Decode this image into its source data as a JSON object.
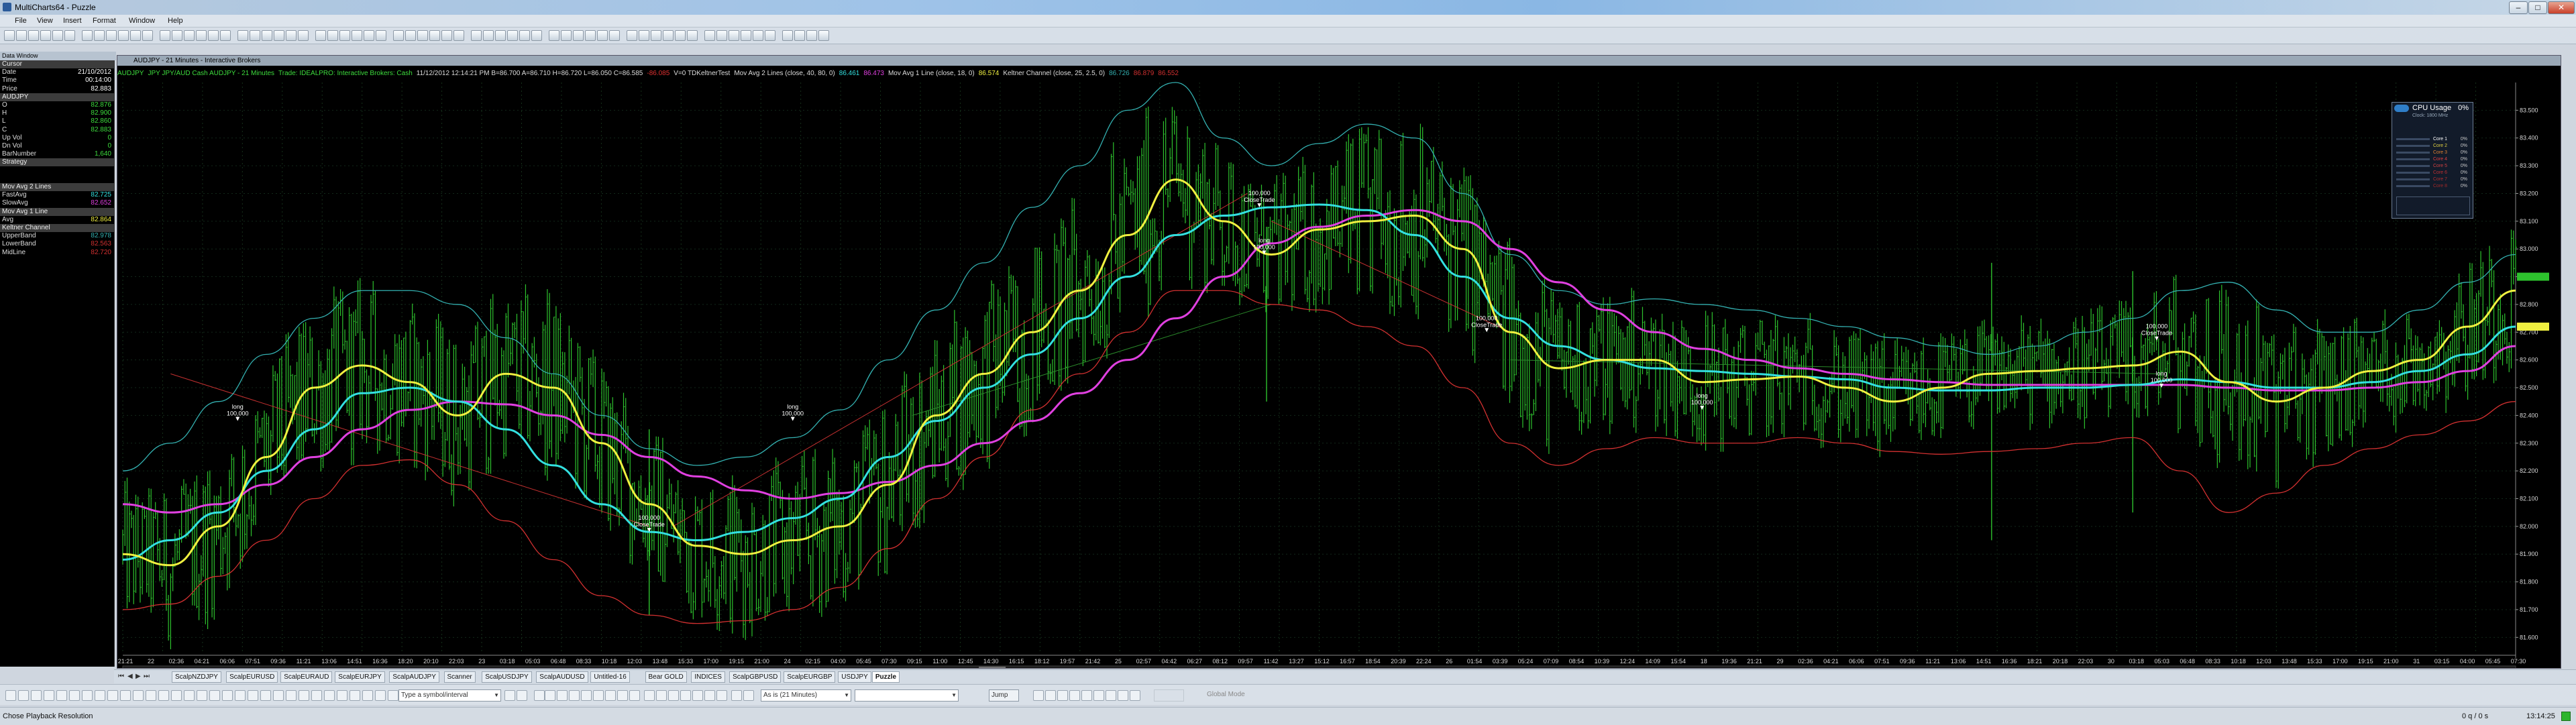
{
  "app": {
    "title": "MultiCharts64 - Puzzle",
    "menu": [
      "File",
      "View",
      "Insert",
      "Format",
      "Window",
      "Help"
    ]
  },
  "data_window": {
    "title": "Data Window",
    "rows": [
      {
        "k": "Cursor",
        "v": "",
        "section": true
      },
      {
        "k": "Date",
        "v": "21/10/2012",
        "color": "#ffffff"
      },
      {
        "k": "Time",
        "v": "00:14:00",
        "color": "#ffffff"
      },
      {
        "k": "Price",
        "v": "82.883",
        "color": "#ffffff"
      },
      {
        "k": "AUDJPY",
        "v": "",
        "section": true
      },
      {
        "k": "O",
        "v": "82.876",
        "color": "#3ddc3d"
      },
      {
        "k": "H",
        "v": "82.900",
        "color": "#3ddc3d"
      },
      {
        "k": "L",
        "v": "82.860",
        "color": "#3ddc3d"
      },
      {
        "k": "C",
        "v": "82.883",
        "color": "#3ddc3d"
      },
      {
        "k": "Up Vol",
        "v": "0",
        "color": "#3ddc3d"
      },
      {
        "k": "Dn Vol",
        "v": "0",
        "color": "#3ddc3d"
      },
      {
        "k": "BarNumber",
        "v": "1,640",
        "color": "#3ddc3d"
      },
      {
        "k": "Strategy",
        "v": "",
        "section": true
      },
      {
        "k": "",
        "v": ""
      },
      {
        "k": "",
        "v": ""
      },
      {
        "k": "Mov Avg 2 Lines",
        "v": "",
        "section": true
      },
      {
        "k": "FastAvg",
        "v": "82.725",
        "color": "#33e0e0"
      },
      {
        "k": "SlowAvg",
        "v": "82.652",
        "color": "#e040e0"
      },
      {
        "k": "Mov Avg 1 Line",
        "v": "",
        "section": true
      },
      {
        "k": "Avg",
        "v": "82.864",
        "color": "#f0f040"
      },
      {
        "k": "Keltner Channel",
        "v": "",
        "section": true
      },
      {
        "k": "UpperBand",
        "v": "82.978",
        "color": "#33b0b0"
      },
      {
        "k": "LowerBand",
        "v": "82.563",
        "color": "#d23030"
      },
      {
        "k": "MidLine",
        "v": "82.720",
        "color": "#d23030"
      }
    ]
  },
  "chart": {
    "window_title": "AUDJPY - 21 Minutes - Interactive Brokers",
    "infobar": [
      {
        "t": "AUDJPY",
        "c": "#3ddc3d"
      },
      {
        "t": "JPY JPY/AUD Cash AUDJPY - 21 Minutes",
        "c": "#3ddc3d"
      },
      {
        "t": "Trade: IDEALPRO: Interactive Brokers: Cash",
        "c": "#3ddc3d"
      },
      {
        "t": "11/12/2012  12:14:21 PM  B=86.700  A=86.710  H=86.720  L=86.050  C=86.585",
        "c": "#dddddd"
      },
      {
        "t": "-86.085",
        "c": "#e03030"
      },
      {
        "t": "V=0  TDKeltnerTest",
        "c": "#dddddd"
      },
      {
        "t": "Mov Avg 2 Lines  (close, 40, 80, 0)",
        "c": "#dddddd"
      },
      {
        "t": "86.461",
        "c": "#33e0e0"
      },
      {
        "t": "86.473",
        "c": "#e040e0"
      },
      {
        "t": "Mov Avg 1 Line  (close, 18, 0)",
        "c": "#dddddd"
      },
      {
        "t": "86.574",
        "c": "#f0f040"
      },
      {
        "t": "Keltner Channel  (close, 25, 2.5, 0)",
        "c": "#dddddd"
      },
      {
        "t": "86.726",
        "c": "#33b0b0"
      },
      {
        "t": "86.879",
        "c": "#d23030"
      },
      {
        "t": "86.552",
        "c": "#d23030"
      }
    ],
    "price_labels": [
      "83.500",
      "83.400",
      "83.300",
      "83.200",
      "83.100",
      "83.000",
      "82.900",
      "82.800",
      "82.700",
      "82.600",
      "82.500",
      "82.400",
      "82.300",
      "82.200",
      "82.100",
      "82.000",
      "81.900",
      "81.800",
      "81.700",
      "81.600"
    ],
    "time_labels": [
      "21:21",
      "22",
      "02:36",
      "04:21",
      "06:06",
      "07:51",
      "09:36",
      "11:21",
      "13:06",
      "14:51",
      "16:36",
      "18:20",
      "20:10",
      "22:03",
      "23",
      "03:18",
      "05:03",
      "06:48",
      "08:33",
      "10:18",
      "12:03",
      "13:48",
      "15:33",
      "17:00",
      "19:15",
      "21:00",
      "24",
      "02:15",
      "04:00",
      "05:45",
      "07:30",
      "09:15",
      "11:00",
      "12:45",
      "14:30",
      "16:15",
      "18:12",
      "19:57",
      "21:42",
      "25",
      "02:57",
      "04:42",
      "06:27",
      "08:12",
      "09:57",
      "11:42",
      "13:27",
      "15:12",
      "16:57",
      "18:54",
      "20:39",
      "22:24",
      "26",
      "01:54",
      "03:39",
      "05:24",
      "07:09",
      "08:54",
      "10:39",
      "12:24",
      "14:09",
      "15:54",
      "18",
      "19:36",
      "21:21",
      "29",
      "02:36",
      "04:21",
      "06:06",
      "07:51",
      "09:36",
      "11:21",
      "13:06",
      "14:51",
      "16:36",
      "18:21",
      "20:18",
      "22:03",
      "30",
      "03:18",
      "05:03",
      "06:48",
      "08:33",
      "10:18",
      "12:03",
      "13:48",
      "15:33",
      "17:00",
      "19:15",
      "21:00",
      "31",
      "03:15",
      "04:00",
      "05:45",
      "07:30"
    ],
    "trade_labels": [
      {
        "label": "long\n100,000",
        "price": 82.38,
        "bar": 0.048
      },
      {
        "label": "100,000\nCloseTrade",
        "price": 81.98,
        "bar": 0.22
      },
      {
        "label": "long\n100,000",
        "price": 82.38,
        "bar": 0.28
      },
      {
        "label": "100,000\nCloseTrade",
        "price": 83.15,
        "bar": 0.475
      },
      {
        "label": "long\n100,000",
        "price": 82.98,
        "bar": 0.477
      },
      {
        "label": "100,000\nCloseTrade",
        "price": 82.7,
        "bar": 0.57
      },
      {
        "label": "long\n100,000",
        "price": 82.42,
        "bar": 0.66
      },
      {
        "label": "100,000\nCloseTrade",
        "price": 82.67,
        "bar": 0.85
      },
      {
        "label": "long\n100,000",
        "price": 82.5,
        "bar": 0.852
      }
    ]
  },
  "chart_data": {
    "type": "line",
    "title": "AUDJPY - 21 Minutes - Interactive Brokers",
    "ylim": [
      81.55,
      83.6
    ],
    "series": [
      {
        "name": "Avg",
        "color": "#f0f040",
        "values": [
          81.9,
          81.86,
          82.0,
          82.25,
          82.5,
          82.58,
          82.52,
          82.4,
          82.55,
          82.5,
          82.3,
          82.08,
          81.93,
          81.9,
          81.95,
          82.0,
          82.15,
          82.4,
          82.55,
          82.7,
          82.85,
          83.05,
          83.25,
          83.1,
          82.98,
          83.07,
          83.1,
          83.12,
          83.0,
          82.7,
          82.57,
          82.6,
          82.6,
          82.52,
          82.53,
          82.54,
          82.5,
          82.45,
          82.5,
          82.55,
          82.56,
          82.57,
          82.58,
          82.63,
          82.52,
          82.45,
          82.5,
          82.56,
          82.6,
          82.72,
          82.85
        ]
      },
      {
        "name": "FastAvg",
        "color": "#33e0e0",
        "values": [
          81.88,
          81.95,
          82.05,
          82.2,
          82.35,
          82.48,
          82.5,
          82.45,
          82.35,
          82.22,
          82.08,
          81.98,
          81.95,
          81.98,
          82.03,
          82.1,
          82.25,
          82.38,
          82.5,
          82.62,
          82.75,
          82.9,
          83.05,
          83.12,
          83.15,
          83.16,
          83.14,
          83.05,
          82.9,
          82.75,
          82.65,
          82.6,
          82.57,
          82.56,
          82.55,
          82.54,
          82.53,
          82.5,
          82.49,
          82.49,
          82.5,
          82.5,
          82.51,
          82.53,
          82.52,
          82.5,
          82.5,
          82.52,
          82.56,
          82.62,
          82.72
        ]
      },
      {
        "name": "SlowAvg",
        "color": "#e040e0",
        "values": [
          82.08,
          82.05,
          82.08,
          82.15,
          82.25,
          82.35,
          82.42,
          82.45,
          82.44,
          82.4,
          82.33,
          82.25,
          82.18,
          82.13,
          82.1,
          82.12,
          82.16,
          82.22,
          82.3,
          82.38,
          82.48,
          82.6,
          82.75,
          82.9,
          83.02,
          83.08,
          83.12,
          83.14,
          83.1,
          83.0,
          82.88,
          82.78,
          82.7,
          82.64,
          82.6,
          82.57,
          82.55,
          82.53,
          82.52,
          82.51,
          82.51,
          82.51,
          82.51,
          82.51,
          82.5,
          82.49,
          82.49,
          82.5,
          82.52,
          82.56,
          82.65
        ]
      },
      {
        "name": "UpperBand",
        "color": "#33b0b0",
        "values": [
          82.2,
          82.3,
          82.45,
          82.62,
          82.75,
          82.85,
          82.85,
          82.8,
          82.68,
          82.55,
          82.4,
          82.28,
          82.22,
          82.25,
          82.32,
          82.42,
          82.6,
          82.78,
          82.95,
          83.15,
          83.3,
          83.5,
          83.6,
          83.4,
          83.3,
          83.38,
          83.45,
          83.4,
          83.2,
          82.98,
          82.85,
          82.8,
          82.82,
          82.8,
          82.78,
          82.75,
          82.72,
          82.68,
          82.65,
          82.62,
          82.65,
          82.7,
          82.75,
          82.85,
          82.88,
          82.78,
          82.7,
          82.7,
          82.78,
          82.88,
          82.98
        ]
      },
      {
        "name": "LowerBand",
        "color": "#d23030",
        "values": [
          81.7,
          81.72,
          81.82,
          81.95,
          82.1,
          82.22,
          82.24,
          82.15,
          82.02,
          81.88,
          81.75,
          81.68,
          81.65,
          81.66,
          81.7,
          81.78,
          81.92,
          82.1,
          82.25,
          82.42,
          82.55,
          82.7,
          82.85,
          82.85,
          82.8,
          82.78,
          82.72,
          82.65,
          82.5,
          82.3,
          82.22,
          82.28,
          82.32,
          82.3,
          82.3,
          82.32,
          82.3,
          82.27,
          82.26,
          82.27,
          82.28,
          82.3,
          82.32,
          82.2,
          82.05,
          82.12,
          82.22,
          82.28,
          82.33,
          82.38,
          82.45
        ]
      }
    ]
  },
  "cpu_widget": {
    "title": "CPU Usage",
    "percent": "0%",
    "header": "Clock: 1800 MHz",
    "cores": [
      {
        "name": "Core 1",
        "val": "0%",
        "color": "#ffffff"
      },
      {
        "name": "Core 2",
        "val": "0%",
        "color": "#e0d040"
      },
      {
        "name": "Core 3",
        "val": "0%",
        "color": "#e08030"
      },
      {
        "name": "Core 4",
        "val": "0%",
        "color": "#e04040"
      },
      {
        "name": "Core 5",
        "val": "0%",
        "color": "#d04040"
      },
      {
        "name": "Core 6",
        "val": "0%",
        "color": "#c03030"
      },
      {
        "name": "Core 7",
        "val": "0%",
        "color": "#b03030"
      },
      {
        "name": "Core 8",
        "val": "0%",
        "color": "#a02828"
      }
    ]
  },
  "sheet_tabs": [
    "ScalpNZDJPY",
    "ScalpEURUSD",
    "ScalpEURAUD",
    "ScalpEURJPY",
    "ScalpAUDJPY",
    "Scanner",
    "ScalpUSDJPY",
    "ScalpAUDUSD",
    "Untitled-16",
    "Bear GOLD",
    "INDICES",
    "ScalpGBPUSD",
    "ScalpEURGBP",
    "USDJPY",
    "Puzzle"
  ],
  "active_tab": "Puzzle",
  "drawbar": {
    "symbol_placeholder": "Type a symbol/interval",
    "resolution": "As is (21 Minutes)",
    "jump": "Jump",
    "global_mode": "Global Mode"
  },
  "status": {
    "left": "Chose Playback Resolution",
    "right1": "0 q / 0 s",
    "right2": "13:14:25"
  }
}
